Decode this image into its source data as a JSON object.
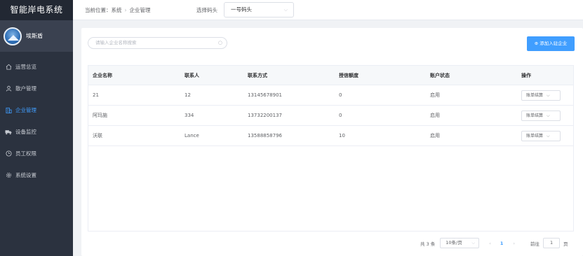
{
  "app": {
    "title": "智能岸电系统"
  },
  "user": {
    "name": "埃斯盾"
  },
  "nav": [
    {
      "label": "运营总览",
      "icon": "home-icon"
    },
    {
      "label": "散户管理",
      "icon": "user-icon"
    },
    {
      "label": "企业管理",
      "icon": "building-icon",
      "active": true
    },
    {
      "label": "设备监控",
      "icon": "truck-icon"
    },
    {
      "label": "员工权限",
      "icon": "clock-icon"
    },
    {
      "label": "系统设置",
      "icon": "gear-icon"
    }
  ],
  "breadcrumb": {
    "prefix": "当前位置：",
    "items": [
      "系统",
      "企业管理"
    ],
    "separator": "›"
  },
  "dock": {
    "label": "选择码头",
    "value": "一号码头"
  },
  "search": {
    "placeholder": "请输入企业名称搜索"
  },
  "add_button": {
    "label": "添加入驻企业"
  },
  "table": {
    "headers": [
      "企业名称",
      "联系人",
      "联系方式",
      "授信额度",
      "账户状态",
      "操作"
    ],
    "rows": [
      {
        "name": "21",
        "contact": "12",
        "phone": "13145678901",
        "credit": "0",
        "status": "启用",
        "action": "账单结算"
      },
      {
        "name": "阿玛施",
        "contact": "334",
        "phone": "13732200137",
        "credit": "0",
        "status": "启用",
        "action": "账单结算"
      },
      {
        "name": "沃联",
        "contact": "Lance",
        "phone": "13588858796",
        "credit": "10",
        "status": "启用",
        "action": "账单结算"
      }
    ]
  },
  "pager": {
    "total": "共 3 条",
    "page_size": "10条/页",
    "prev": "‹",
    "current": "1",
    "next": "›",
    "goto_label": "前往",
    "goto_value": "1",
    "goto_unit": "页"
  },
  "colors": {
    "sidebar": "#2b323f",
    "accent": "#409eff"
  }
}
